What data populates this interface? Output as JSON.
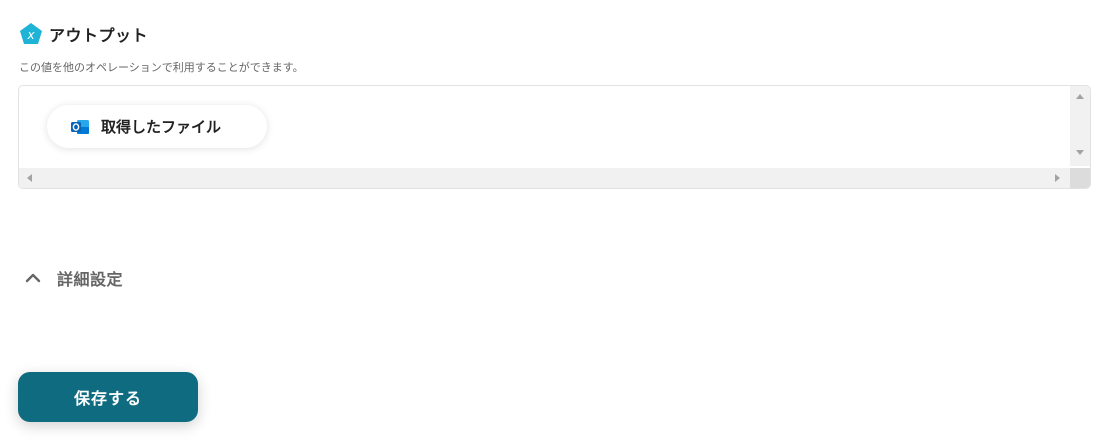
{
  "output": {
    "icon": "x-pentagon-icon",
    "title": "アウトプット",
    "description": "この値を他のオペレーションで利用することができます。",
    "items": [
      {
        "icon": "outlook-icon",
        "label": "取得したファイル"
      }
    ]
  },
  "advanced": {
    "icon": "chevron-up-icon",
    "label": "詳細設定"
  },
  "save_button": {
    "label": "保存する"
  },
  "colors": {
    "accent": "#0f6b80",
    "icon_teal": "#1fb3d6",
    "outlook_blue": "#0a64b5"
  }
}
